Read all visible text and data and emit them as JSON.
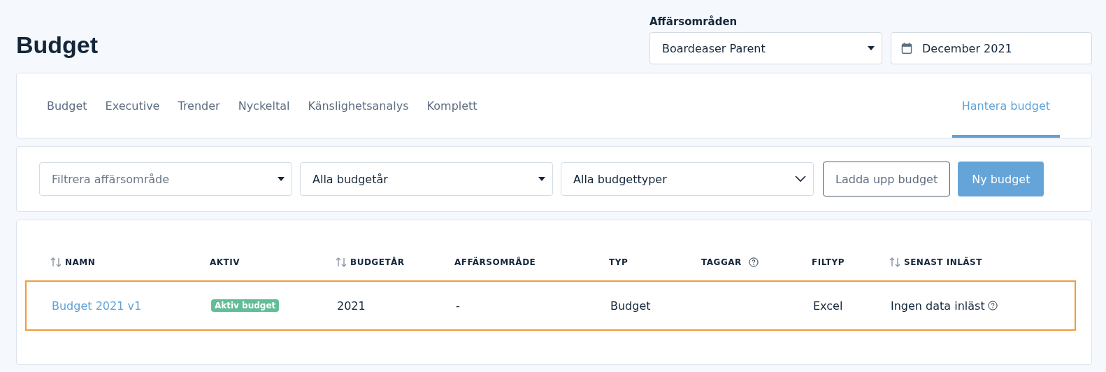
{
  "page_title": "Budget",
  "business_area": {
    "label": "Affärsområden",
    "value": "Boardeaser Parent"
  },
  "date": {
    "value": "December 2021"
  },
  "tabs": [
    {
      "label": "Budget",
      "selected": false
    },
    {
      "label": "Executive",
      "selected": false
    },
    {
      "label": "Trender",
      "selected": false
    },
    {
      "label": "Nyckeltal",
      "selected": false
    },
    {
      "label": "Känslighetsanalys",
      "selected": false
    },
    {
      "label": "Komplett",
      "selected": false
    },
    {
      "label": "Hantera budget",
      "selected": true
    }
  ],
  "filters": [
    {
      "kind": "select",
      "placeholder": "Filtrera affärsområde"
    },
    {
      "kind": "select",
      "value": "Alla budgetår"
    },
    {
      "kind": "chevron",
      "value": "Alla budgettyper"
    }
  ],
  "buttons": [
    {
      "kind": "outline",
      "label": "Ladda upp budget"
    },
    {
      "kind": "primary",
      "label": "Ny budget"
    }
  ],
  "table": {
    "columns": [
      {
        "label": "NAMN",
        "sortable": true
      },
      {
        "label": "AKTIV",
        "sortable": false
      },
      {
        "label": "BUDGETÅR",
        "sortable": true
      },
      {
        "label": "AFFÄRSOMRÅDE",
        "sortable": false
      },
      {
        "label": "TYP",
        "sortable": false
      },
      {
        "label": "TAGGAR",
        "sortable": false,
        "help": true
      },
      {
        "label": "FILTYP",
        "sortable": false
      },
      {
        "label": "SENAST INLÄST",
        "sortable": true
      }
    ],
    "rows": [
      {
        "selected": true,
        "name": "Budget 2021 v1",
        "active_badge": "Aktiv budget",
        "year": "2021",
        "business_area": "-",
        "type": "Budget",
        "file_type": "Excel",
        "last_loaded": "Ingen data inläst",
        "last_loaded_help": true
      }
    ]
  }
}
